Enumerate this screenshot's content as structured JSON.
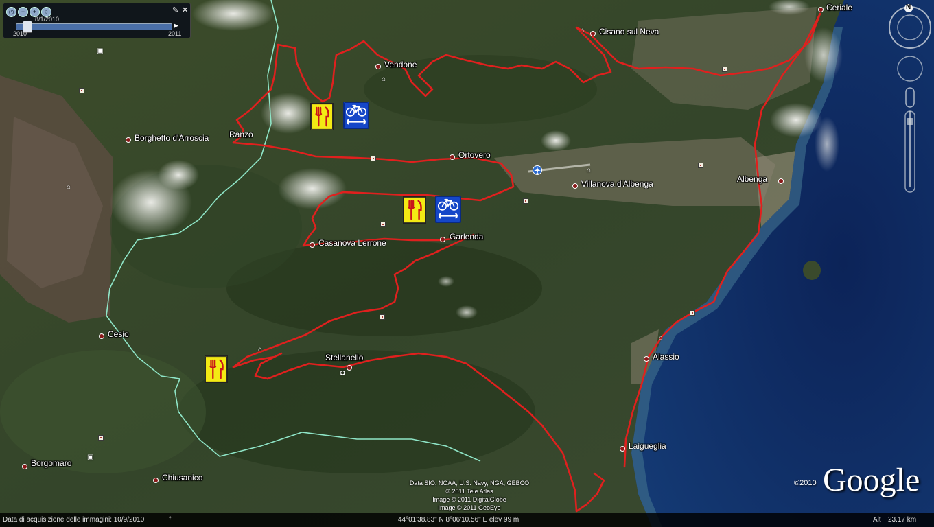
{
  "time_slider": {
    "current_date": "8/1/2010",
    "start_label": "2010",
    "end_label": "2011"
  },
  "places": [
    {
      "id": "ceriale",
      "name": "Ceriale"
    },
    {
      "id": "cisano",
      "name": "Cisano sul Neva"
    },
    {
      "id": "vendone",
      "name": "Vendone"
    },
    {
      "id": "borghetto",
      "name": "Borghetto d'Arroscia"
    },
    {
      "id": "ranzo",
      "name": "Ranzo"
    },
    {
      "id": "ortovero",
      "name": "Ortovero"
    },
    {
      "id": "villanova",
      "name": "Villanova d'Albenga"
    },
    {
      "id": "albenga",
      "name": "Albenga"
    },
    {
      "id": "casanova",
      "name": "Casanova Lerrone"
    },
    {
      "id": "garlenda",
      "name": "Garlenda"
    },
    {
      "id": "cesio",
      "name": "Cesio"
    },
    {
      "id": "stellanello",
      "name": "Stellanello"
    },
    {
      "id": "alassio",
      "name": "Alassio"
    },
    {
      "id": "laigueglia",
      "name": "Laigueglia"
    },
    {
      "id": "borgomaro",
      "name": "Borgomaro"
    },
    {
      "id": "chiusanico",
      "name": "Chiusanico"
    }
  ],
  "map_overlay": {
    "attribution_lines": [
      "Data SIO, NOAA, U.S. Navy, NGA, GEBCO",
      "© 2011 Tele Atlas",
      "Image © 2011 DigitalGlobe",
      "Image © 2011 GeoEye"
    ],
    "copyright": "©2010",
    "logo": "Google"
  },
  "status_bar": {
    "acquisition_date": "Data di acquisizione delle immagini: 10/9/2010",
    "coordinates": "44°01'38.83\" N    8°06'10.56\" E   elev   99 m",
    "altitude_label": "Alt",
    "altitude_value": "23.17 km"
  },
  "navigation": {
    "north_label": "N"
  },
  "colors": {
    "route": "#e0201e",
    "boundary": "#8fe6c8",
    "sea": "#0f2a5c",
    "food_sign": "#f3ea14",
    "bike_sign": "#1547c8"
  },
  "icons": [
    "restaurant-icon",
    "bike-repair-icon",
    "museum-icon",
    "airport-icon",
    "camera-icon",
    "zoom-in-icon",
    "zoom-out-icon",
    "wrench-icon",
    "close-icon"
  ]
}
